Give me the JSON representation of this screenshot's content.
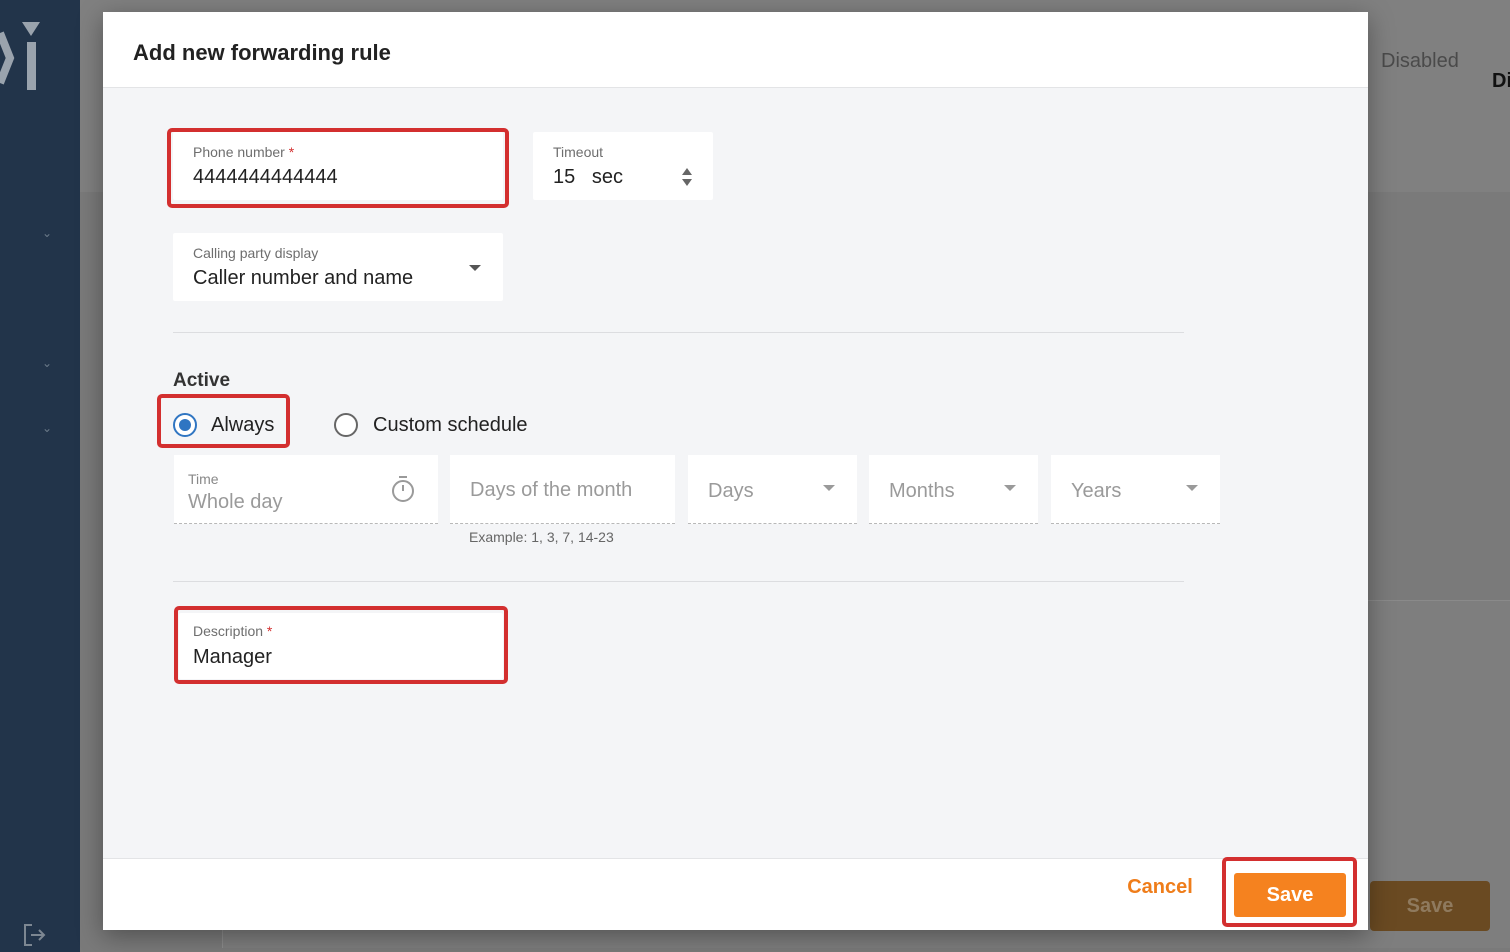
{
  "background": {
    "status_text": "Disabled",
    "col_header_partial": "Di",
    "save_label": "Save"
  },
  "dialog": {
    "title": "Add new forwarding rule",
    "phone": {
      "label": "Phone number",
      "required": "*",
      "value": "4444444444444"
    },
    "timeout": {
      "label": "Timeout",
      "value": "15",
      "unit": "sec"
    },
    "calling_party": {
      "label": "Calling party display",
      "value": "Caller number and name"
    },
    "active": {
      "title": "Active",
      "options": [
        {
          "label": "Always",
          "checked": true
        },
        {
          "label": "Custom schedule",
          "checked": false
        }
      ]
    },
    "schedule": {
      "time_label": "Time",
      "time_value": "Whole day",
      "days_of_month_placeholder": "Days of the month",
      "days_of_month_hint": "Example: 1, 3, 7, 14-23",
      "days_placeholder": "Days",
      "months_placeholder": "Months",
      "years_placeholder": "Years"
    },
    "description": {
      "label": "Description",
      "required": "*",
      "value": "Manager"
    },
    "footer": {
      "cancel_label": "Cancel",
      "save_label": "Save"
    }
  },
  "colors": {
    "accent": "#f5821f",
    "highlight": "#d32f2f",
    "radio_selected": "#2f75c2",
    "sidebar": "#22344a"
  },
  "icons": [
    "logout-icon",
    "stopwatch-icon",
    "chevron-down-icon",
    "stepper-icon",
    "dropdown-caret-icon"
  ]
}
